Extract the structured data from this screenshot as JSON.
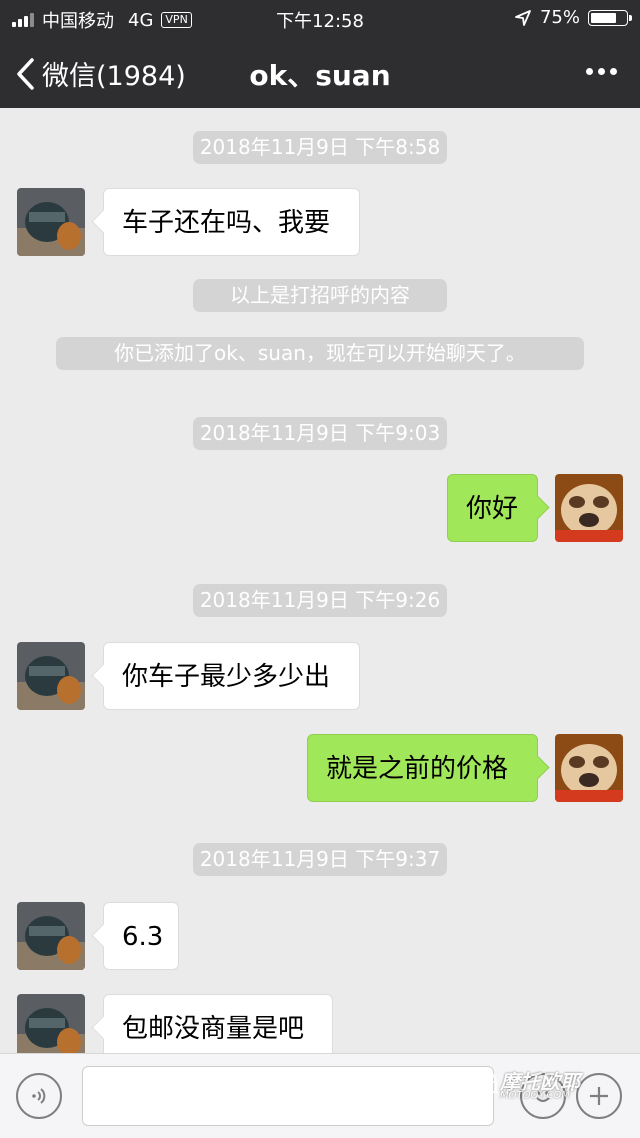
{
  "status_bar": {
    "carrier": "中国移动",
    "network": "4G",
    "vpn": "VPN",
    "time": "下午12:58",
    "battery": "75%",
    "battery_level": 0.75
  },
  "nav": {
    "back_label": "微信(1984)",
    "title": "ok、suan"
  },
  "chat": {
    "timestamp_1": "2018年11月9日 下午8:58",
    "msg_1": "车子还在吗、我要",
    "system_1": "以上是打招呼的内容",
    "system_2": "你已添加了ok、suan，现在可以开始聊天了。",
    "timestamp_2": "2018年11月9日 下午9:03",
    "msg_2": "你好",
    "timestamp_3": "2018年11月9日 下午9:26",
    "msg_3": "你车子最少多少出",
    "msg_4": "就是之前的价格",
    "timestamp_4": "2018年11月9日 下午9:37",
    "msg_5": "6.3",
    "msg_6": "包邮没商量是吧"
  },
  "input": {
    "value": ""
  },
  "watermark": {
    "main": "摩托欧耶",
    "sub": "MOTOOY.COM"
  },
  "colors": {
    "bar": "#2e2e31",
    "chat_bg": "#ebebeb",
    "outgoing_bubble": "#a0e75a",
    "system_notice": "#d4d4d4"
  }
}
